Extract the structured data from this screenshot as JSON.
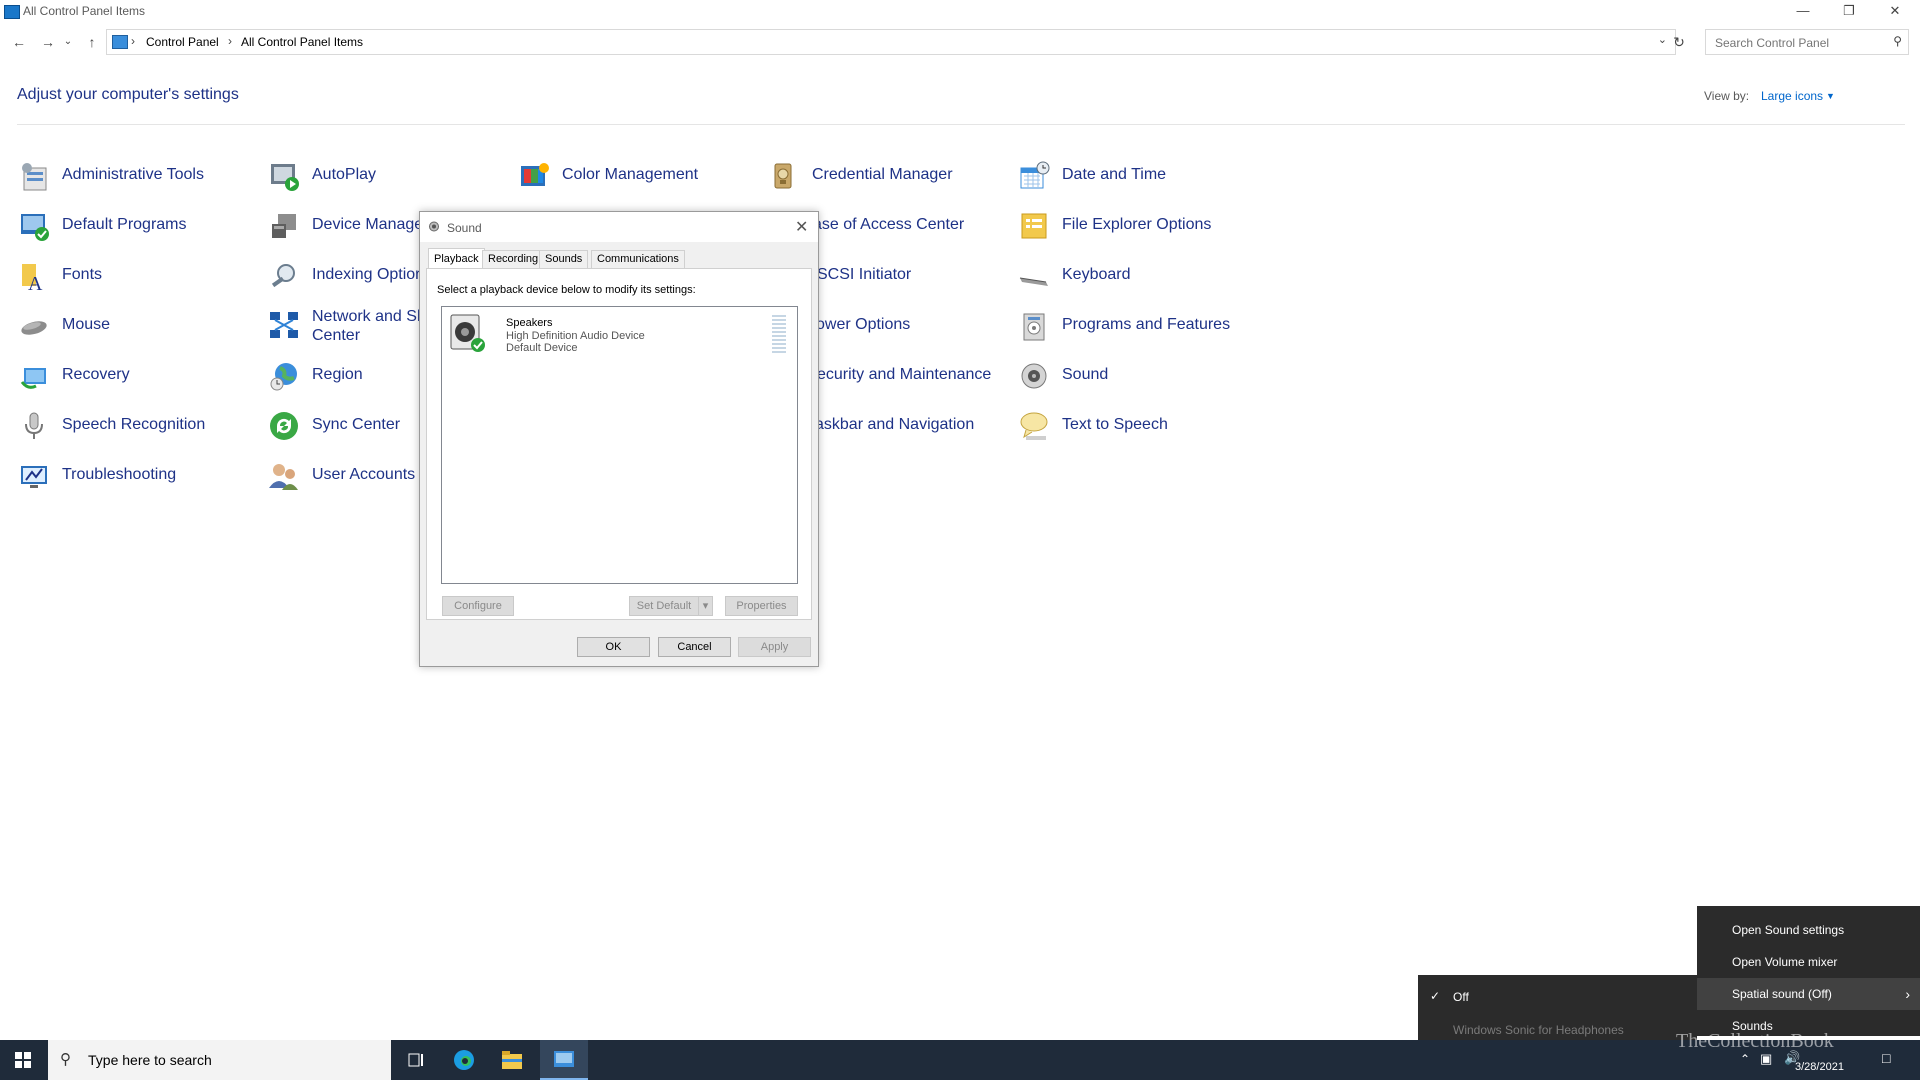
{
  "window": {
    "title": "All Control Panel Items"
  },
  "address": {
    "breadcrumbs": [
      "Control Panel",
      "All Control Panel Items"
    ],
    "search_placeholder": "Search Control Panel"
  },
  "header": {
    "heading": "Adjust your computer's settings",
    "view_by_label": "View by:",
    "view_by_value": "Large icons"
  },
  "items": [
    {
      "label": "Administrative Tools",
      "icon": "admin-tools-icon"
    },
    {
      "label": "AutoPlay",
      "icon": "autoplay-icon"
    },
    {
      "label": "Color Management",
      "icon": "color-management-icon"
    },
    {
      "label": "Credential Manager",
      "icon": "credential-manager-icon"
    },
    {
      "label": "Date and Time",
      "icon": "date-time-icon"
    },
    {
      "label": "Default Programs",
      "icon": "default-programs-icon"
    },
    {
      "label": "Device Manage",
      "icon": "device-manager-icon"
    },
    {
      "label": "ase of Access Center",
      "icon": "ease-of-access-icon"
    },
    {
      "label": "File Explorer Options",
      "icon": "file-explorer-options-icon"
    },
    {
      "label": "Fonts",
      "icon": "fonts-icon"
    },
    {
      "label": "Indexing Optior",
      "icon": "indexing-options-icon"
    },
    {
      "label": "SCSI Initiator",
      "icon": "iscsi-initiator-icon"
    },
    {
      "label": "Keyboard",
      "icon": "keyboard-icon"
    },
    {
      "label": "Mouse",
      "icon": "mouse-icon"
    },
    {
      "label": "Network and Sh",
      "label2": "Center",
      "icon": "network-sharing-icon"
    },
    {
      "label": "ower Options",
      "icon": "power-options-icon"
    },
    {
      "label": "Programs and Features",
      "icon": "programs-features-icon"
    },
    {
      "label": "Recovery",
      "icon": "recovery-icon"
    },
    {
      "label": "Region",
      "icon": "region-icon"
    },
    {
      "label": "ecurity and Maintenance",
      "icon": "security-maintenance-icon"
    },
    {
      "label": "Sound",
      "icon": "sound-icon"
    },
    {
      "label": "Speech Recognition",
      "icon": "speech-recognition-icon"
    },
    {
      "label": "Sync Center",
      "icon": "sync-center-icon"
    },
    {
      "label": "askbar and Navigation",
      "icon": "taskbar-navigation-icon"
    },
    {
      "label": "Text to Speech",
      "icon": "text-to-speech-icon"
    },
    {
      "label": "Troubleshooting",
      "icon": "troubleshooting-icon"
    },
    {
      "label": "User Accounts",
      "icon": "user-accounts-icon"
    }
  ],
  "sound_dialog": {
    "title": "Sound",
    "tabs": [
      "Playback",
      "Recording",
      "Sounds",
      "Communications"
    ],
    "instruction": "Select a playback device below to modify its settings:",
    "device": {
      "name": "Speakers",
      "description": "High Definition Audio Device",
      "status": "Default Device"
    },
    "buttons": {
      "configure": "Configure",
      "set_default": "Set Default",
      "properties": "Properties",
      "ok": "OK",
      "cancel": "Cancel",
      "apply": "Apply"
    }
  },
  "context_menu": {
    "items": [
      "Open Sound settings",
      "Open Volume mixer",
      "Spatial sound (Off)",
      "Sounds"
    ],
    "submenu": [
      "Off",
      "Windows Sonic for Headphones"
    ]
  },
  "taskbar": {
    "search_placeholder": "Type here to search",
    "date": "3/28/2021"
  },
  "watermark": "TheCollectionBook",
  "colors": {
    "link": "#1e3287",
    "accent": "#0066cc",
    "taskbar": "#1f2b3a",
    "menu": "#2b2b2b"
  }
}
